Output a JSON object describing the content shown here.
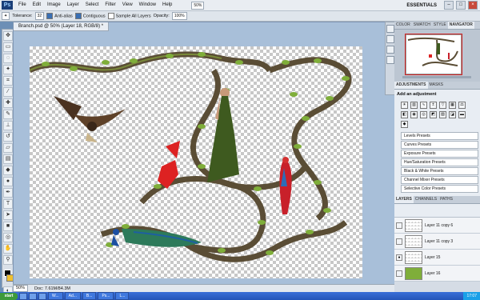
{
  "app": {
    "logo": "Ps"
  },
  "menu": [
    "File",
    "Edit",
    "Image",
    "Layer",
    "Select",
    "Filter",
    "View",
    "Window",
    "Help"
  ],
  "menu_right": {
    "zoom": "50%",
    "workspace": "ESSENTIALS"
  },
  "options": {
    "tolerance_label": "Tolerance:",
    "tolerance_value": "32",
    "anti_alias": "Anti-alias",
    "contiguous": "Contiguous",
    "sample_all": "Sample All Layers",
    "opacity_label": "Opacity:",
    "opacity_value": "100%"
  },
  "document": {
    "tab_title": "Branch.psd @ 50% (Layer 18, RGB/8) *"
  },
  "status": {
    "zoom": "50%",
    "doc": "Doc: 7.61M/84.3M"
  },
  "navigator": {
    "tabs": [
      "COLOR",
      "SWATCH",
      "STYLE",
      "NAVIGATOR"
    ]
  },
  "adjustments": {
    "tabs": [
      "ADJUSTMENTS",
      "MASKS"
    ],
    "heading": "Add an adjustment",
    "presets": [
      "Levels Presets",
      "Curves Presets",
      "Exposure Presets",
      "Hue/Saturation Presets",
      "Black & White Presets",
      "Channel Mixer Presets",
      "Selective Color Presets"
    ]
  },
  "layers": {
    "tabs": [
      "LAYERS",
      "CHANNELS",
      "PATHS"
    ],
    "items": [
      {
        "name": "Layer 11 copy 6"
      },
      {
        "name": "Layer 11 copy 3"
      },
      {
        "name": "Layer 15"
      },
      {
        "name": "Layer 16"
      }
    ]
  },
  "taskbar": {
    "start": "start",
    "items": [
      "W...",
      "Ad...",
      "B...",
      "Ps...",
      "L..."
    ],
    "clock": "17:07"
  },
  "colors": {
    "accent": "#2454b8",
    "canvas_bg": "#6d8fb6"
  }
}
